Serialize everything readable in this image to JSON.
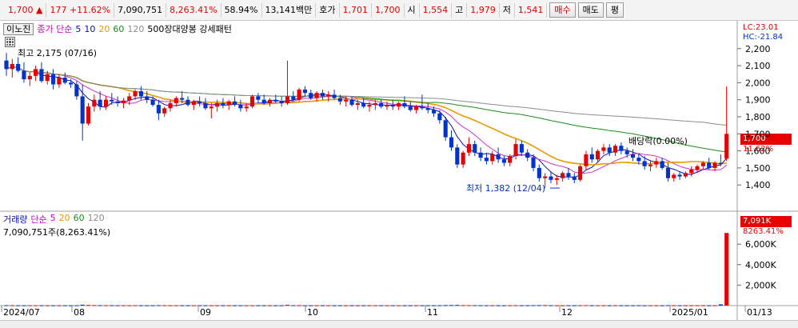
{
  "header": {
    "price": "1,700",
    "change_symbol": "▲",
    "change": "177",
    "change_pct": "+11.62%",
    "volume": "7,090,751",
    "volume_ratio": "8,263.41%",
    "turnover": "58.94%",
    "amount": "13,141백만",
    "quote_label": "호가",
    "ask": "1,701",
    "bid": "1,700",
    "open_label": "시",
    "open": "1,554",
    "high_label": "고",
    "high": "1,979",
    "low_label": "저",
    "low": "1,541",
    "buy_button": "매수",
    "sell_button": "매도",
    "eval_button": "평"
  },
  "legend": {
    "name": "이노진",
    "type": "종가 단순",
    "ma5": "5",
    "ma10": "10",
    "ma20": "20",
    "ma60": "60",
    "ma120": "120",
    "pattern": "500장대양봉 강세패턴",
    "settings_icon": "grid-icon"
  },
  "volume_legend": {
    "title": "거래량",
    "type": "단순",
    "ma5": "5",
    "ma20": "20",
    "ma60": "60",
    "ma120": "120",
    "current": "7,090,751주(8,263.41%)"
  },
  "right_axis": {
    "lc": "LC:23.01",
    "hc": "HC:-21.84",
    "price_tag": "1,700",
    "pct_tag": "11.62%",
    "vol_tag": "7,091K",
    "vol_pct_tag": "8263.41%",
    "price_ticks": [
      "2,200",
      "2,100",
      "2,000",
      "1,900",
      "1,800",
      "1,700",
      "1,600",
      "1,500",
      "1,400"
    ],
    "volume_ticks": [
      "6,000K",
      "4,000K",
      "2,000K"
    ]
  },
  "annotations": {
    "high": "최고 2,175 (07/16)",
    "low": "최저 1,382 (12/04)",
    "dividend": "배당락(0.00%)"
  },
  "x_labels": [
    "2024/07",
    "08",
    "09",
    "10",
    "11",
    "12",
    "2025/01",
    "01/13"
  ],
  "colors": {
    "up": "#e60000",
    "down": "#0033cc",
    "ma5": "#0d0daa",
    "ma10": "#cc33cc",
    "ma20": "#e69a00",
    "ma60": "#1a8f1a",
    "ma120": "#8c8c8c"
  },
  "chart_data": {
    "type": "candlestick",
    "ylim": [
      1340,
      2260
    ],
    "volume_ylim": [
      0,
      7500
    ],
    "candles": [
      [
        2130,
        2175,
        2040,
        2080
      ],
      [
        2080,
        2140,
        2030,
        2110
      ],
      [
        2110,
        2150,
        2060,
        2070
      ],
      [
        2070,
        2120,
        2000,
        2020
      ],
      [
        2020,
        2060,
        1980,
        2040
      ],
      [
        2040,
        2100,
        2010,
        2080
      ],
      [
        2080,
        2120,
        2000,
        2010
      ],
      [
        2010,
        2070,
        1990,
        2050
      ],
      [
        2050,
        2080,
        1960,
        1990
      ],
      [
        1990,
        2050,
        1970,
        2030
      ],
      [
        2030,
        2060,
        1990,
        2000
      ],
      [
        2000,
        2020,
        1970,
        1990
      ],
      [
        1990,
        2010,
        1900,
        1920
      ],
      [
        1920,
        1990,
        1660,
        1760
      ],
      [
        1760,
        1880,
        1750,
        1860
      ],
      [
        1860,
        1930,
        1830,
        1900
      ],
      [
        1900,
        1950,
        1840,
        1860
      ],
      [
        1860,
        1920,
        1840,
        1900
      ],
      [
        1900,
        1940,
        1870,
        1890
      ],
      [
        1890,
        1920,
        1860,
        1880
      ],
      [
        1880,
        1910,
        1850,
        1895
      ],
      [
        1895,
        1940,
        1870,
        1920
      ],
      [
        1920,
        1960,
        1900,
        1950
      ],
      [
        1950,
        1980,
        1900,
        1920
      ],
      [
        1920,
        1950,
        1880,
        1900
      ],
      [
        1900,
        1920,
        1860,
        1870
      ],
      [
        1870,
        1900,
        1780,
        1820
      ],
      [
        1820,
        1860,
        1800,
        1850
      ],
      [
        1850,
        1900,
        1830,
        1880
      ],
      [
        1880,
        1920,
        1860,
        1910
      ],
      [
        1910,
        1950,
        1880,
        1900
      ],
      [
        1900,
        1920,
        1860,
        1870
      ],
      [
        1870,
        1900,
        1840,
        1890
      ],
      [
        1890,
        1920,
        1860,
        1880
      ],
      [
        1880,
        1910,
        1840,
        1850
      ],
      [
        1850,
        1880,
        1790,
        1860
      ],
      [
        1860,
        1900,
        1830,
        1880
      ],
      [
        1880,
        1910,
        1850,
        1870
      ],
      [
        1870,
        1900,
        1840,
        1890
      ],
      [
        1890,
        1920,
        1860,
        1870
      ],
      [
        1870,
        1900,
        1830,
        1850
      ],
      [
        1850,
        1880,
        1830,
        1860
      ],
      [
        1860,
        1930,
        1850,
        1920
      ],
      [
        1920,
        1940,
        1880,
        1900
      ],
      [
        1900,
        1930,
        1870,
        1880
      ],
      [
        1880,
        1910,
        1860,
        1900
      ],
      [
        1900,
        1930,
        1880,
        1890
      ],
      [
        1890,
        1920,
        1860,
        1880
      ],
      [
        1880,
        2130,
        1870,
        1920
      ],
      [
        1920,
        1950,
        1890,
        1900
      ],
      [
        1900,
        1970,
        1890,
        1960
      ],
      [
        1960,
        1980,
        1920,
        1940
      ],
      [
        1940,
        1960,
        1900,
        1910
      ],
      [
        1910,
        1950,
        1890,
        1940
      ],
      [
        1940,
        1960,
        1900,
        1920
      ],
      [
        1920,
        1950,
        1890,
        1930
      ],
      [
        1930,
        1960,
        1900,
        1910
      ],
      [
        1910,
        1930,
        1870,
        1890
      ],
      [
        1890,
        1920,
        1860,
        1900
      ],
      [
        1900,
        1920,
        1860,
        1870
      ],
      [
        1870,
        1900,
        1840,
        1880
      ],
      [
        1880,
        1910,
        1850,
        1860
      ],
      [
        1860,
        1890,
        1830,
        1870
      ],
      [
        1870,
        1900,
        1840,
        1880
      ],
      [
        1880,
        1900,
        1850,
        1860
      ],
      [
        1860,
        1890,
        1840,
        1870
      ],
      [
        1870,
        1900,
        1840,
        1860
      ],
      [
        1860,
        1890,
        1840,
        1880
      ],
      [
        1880,
        1920,
        1850,
        1860
      ],
      [
        1860,
        1890,
        1830,
        1840
      ],
      [
        1840,
        1870,
        1820,
        1860
      ],
      [
        1860,
        1930,
        1840,
        1850
      ],
      [
        1850,
        1880,
        1820,
        1840
      ],
      [
        1840,
        1860,
        1800,
        1820
      ],
      [
        1820,
        1840,
        1760,
        1780
      ],
      [
        1780,
        1800,
        1660,
        1680
      ],
      [
        1680,
        1720,
        1600,
        1620
      ],
      [
        1620,
        1640,
        1500,
        1520
      ],
      [
        1520,
        1600,
        1500,
        1590
      ],
      [
        1590,
        1680,
        1570,
        1640
      ],
      [
        1640,
        1660,
        1570,
        1590
      ],
      [
        1590,
        1620,
        1540,
        1560
      ],
      [
        1560,
        1590,
        1520,
        1540
      ],
      [
        1540,
        1600,
        1520,
        1580
      ],
      [
        1580,
        1620,
        1530,
        1550
      ],
      [
        1550,
        1570,
        1510,
        1530
      ],
      [
        1530,
        1580,
        1510,
        1570
      ],
      [
        1570,
        1670,
        1550,
        1640
      ],
      [
        1640,
        1660,
        1570,
        1590
      ],
      [
        1590,
        1610,
        1540,
        1560
      ],
      [
        1560,
        1580,
        1480,
        1500
      ],
      [
        1500,
        1520,
        1420,
        1440
      ],
      [
        1440,
        1470,
        1382,
        1450
      ],
      [
        1450,
        1480,
        1410,
        1430
      ],
      [
        1430,
        1460,
        1400,
        1440
      ],
      [
        1440,
        1480,
        1420,
        1470
      ],
      [
        1470,
        1500,
        1430,
        1450
      ],
      [
        1450,
        1470,
        1410,
        1430
      ],
      [
        1430,
        1520,
        1420,
        1510
      ],
      [
        1510,
        1600,
        1490,
        1580
      ],
      [
        1580,
        1620,
        1530,
        1550
      ],
      [
        1550,
        1610,
        1530,
        1600
      ],
      [
        1600,
        1640,
        1580,
        1620
      ],
      [
        1620,
        1640,
        1570,
        1590
      ],
      [
        1590,
        1640,
        1570,
        1630
      ],
      [
        1630,
        1650,
        1580,
        1600
      ],
      [
        1600,
        1620,
        1560,
        1580
      ],
      [
        1580,
        1610,
        1540,
        1560
      ],
      [
        1560,
        1580,
        1520,
        1540
      ],
      [
        1540,
        1570,
        1490,
        1510
      ],
      [
        1510,
        1540,
        1480,
        1520
      ],
      [
        1520,
        1560,
        1500,
        1540
      ],
      [
        1540,
        1560,
        1490,
        1500
      ],
      [
        1500,
        1530,
        1420,
        1440
      ],
      [
        1440,
        1470,
        1420,
        1460
      ],
      [
        1460,
        1480,
        1430,
        1450
      ],
      [
        1450,
        1480,
        1440,
        1470
      ],
      [
        1470,
        1510,
        1450,
        1490
      ],
      [
        1490,
        1520,
        1470,
        1510
      ],
      [
        1510,
        1540,
        1490,
        1530
      ],
      [
        1530,
        1560,
        1490,
        1500
      ],
      [
        1500,
        1540,
        1480,
        1530
      ],
      [
        1530,
        1580,
        1510,
        1523
      ],
      [
        1554,
        1979,
        1541,
        1700
      ]
    ],
    "volume": [
      40,
      35,
      30,
      28,
      30,
      32,
      30,
      28,
      26,
      30,
      28,
      25,
      30,
      90,
      60,
      45,
      40,
      35,
      35,
      30,
      30,
      32,
      35,
      30,
      28,
      28,
      40,
      35,
      30,
      30,
      32,
      28,
      28,
      30,
      28,
      32,
      30,
      28,
      28,
      26,
      28,
      26,
      30,
      28,
      26,
      28,
      26,
      28,
      80,
      35,
      35,
      30,
      28,
      30,
      28,
      28,
      26,
      28,
      26,
      28,
      26,
      26,
      28,
      26,
      28,
      26,
      28,
      26,
      28,
      26,
      28,
      30,
      28,
      26,
      35,
      50,
      55,
      60,
      45,
      40,
      35,
      32,
      30,
      30,
      28,
      28,
      30,
      35,
      30,
      28,
      40,
      45,
      50,
      35,
      30,
      28,
      30,
      28,
      35,
      40,
      32,
      30,
      30,
      28,
      30,
      28,
      26,
      28,
      30,
      28,
      26,
      28,
      26,
      40,
      30,
      28,
      26,
      28,
      30,
      28,
      26,
      28,
      120,
      7091
    ]
  }
}
